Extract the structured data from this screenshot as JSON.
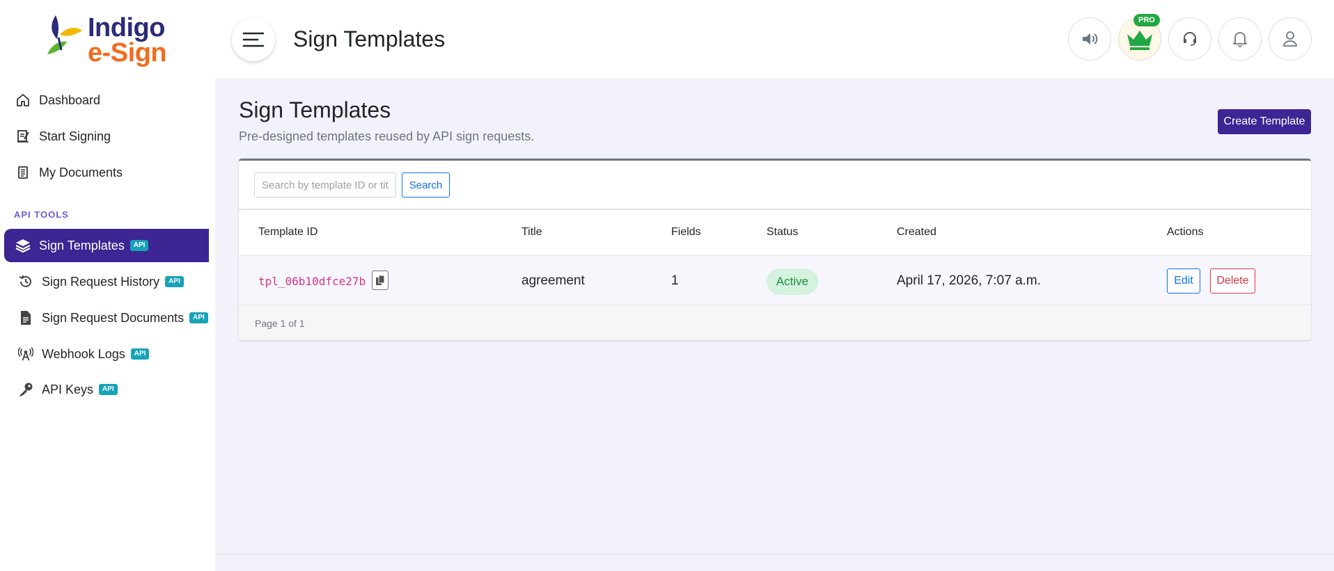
{
  "brand": {
    "line1": "Indigo",
    "line2": "e-Sign"
  },
  "sidebar": {
    "items": [
      {
        "label": "Dashboard"
      },
      {
        "label": "Start Signing"
      },
      {
        "label": "My Documents"
      }
    ],
    "section_label": "API TOOLS",
    "api_items": [
      {
        "label": "Sign Templates",
        "badge": "API"
      },
      {
        "label": "Sign Request History",
        "badge": "API"
      },
      {
        "label": "Sign Request Documents",
        "badge": "API"
      },
      {
        "label": "Webhook Logs",
        "badge": "API"
      },
      {
        "label": "API Keys",
        "badge": "API"
      }
    ]
  },
  "header": {
    "title": "Sign Templates",
    "pro_badge": "PRO"
  },
  "main": {
    "title": "Sign Templates",
    "subtitle": "Pre-designed templates reused by API sign requests.",
    "create_button": "Create Template",
    "search": {
      "placeholder": "Search by template ID or title",
      "value": "",
      "button": "Search"
    },
    "columns": [
      "Template ID",
      "Title",
      "Fields",
      "Status",
      "Created",
      "Actions"
    ],
    "rows": [
      {
        "template_id": "tpl_06b10dfce27b",
        "title": "agreement",
        "fields": "1",
        "status": "Active",
        "created": "April 17, 2026, 7:07 a.m.",
        "edit": "Edit",
        "delete": "Delete"
      }
    ],
    "pagination": "Page 1 of 1"
  },
  "colors": {
    "accent": "#3d2593",
    "api_badge": "#17a2b8",
    "status_active_bg": "#d4f2de",
    "status_active_text": "#1e8f44",
    "template_id": "#d63384"
  }
}
